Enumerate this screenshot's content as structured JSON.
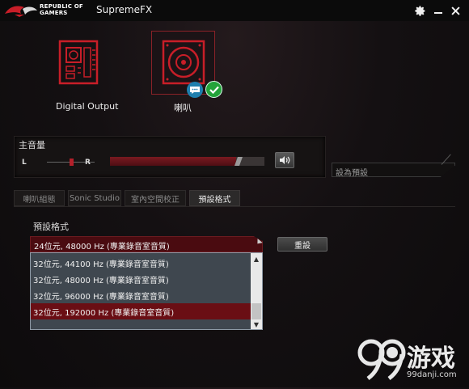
{
  "titlebar": {
    "brand_line1": "REPUBLIC OF",
    "brand_line2": "GAMERS",
    "app_title": "SupremeFX",
    "icons": [
      "settings-gear-icon",
      "minimize-icon",
      "close-icon"
    ]
  },
  "devices": [
    {
      "label": "Digital Output",
      "icon": "digital-output-icon"
    },
    {
      "label": "喇叭",
      "icon": "speaker-icon",
      "badges": [
        "chat-bubble-icon",
        "checkmark-icon"
      ],
      "selected": true
    }
  ],
  "volume": {
    "title": "主音量",
    "left_label": "L",
    "right_label": "R",
    "level_fraction": 0.83,
    "balance_fraction": 0.5,
    "mute_icon": "speaker-volume-icon"
  },
  "preset": {
    "placeholder": "設為預設"
  },
  "tabs": [
    {
      "label": "喇叭組態",
      "active": false
    },
    {
      "label": "Sonic Studio",
      "active": false
    },
    {
      "label": "室內空間校正",
      "active": false
    },
    {
      "label": "預設格式",
      "active": true
    }
  ],
  "format": {
    "label": "預設格式",
    "selected": "24位元, 48000 Hz (專業錄音室音質)",
    "apply_label": "重設",
    "options": [
      "32位元, 44100 Hz (專業錄音室音質)",
      "32位元, 48000 Hz (專業錄音室音質)",
      "32位元, 96000 Hz (專業錄音室音質)",
      "32位元, 192000 Hz (專業錄音室音質)"
    ],
    "highlighted_index": 3
  },
  "watermark": {
    "text_cn": "游戏",
    "url": "99danji.com"
  },
  "colors": {
    "accent": "#b3202a",
    "selection": "#6a0e14",
    "check": "#23a33a",
    "chat": "#1f7fae"
  }
}
